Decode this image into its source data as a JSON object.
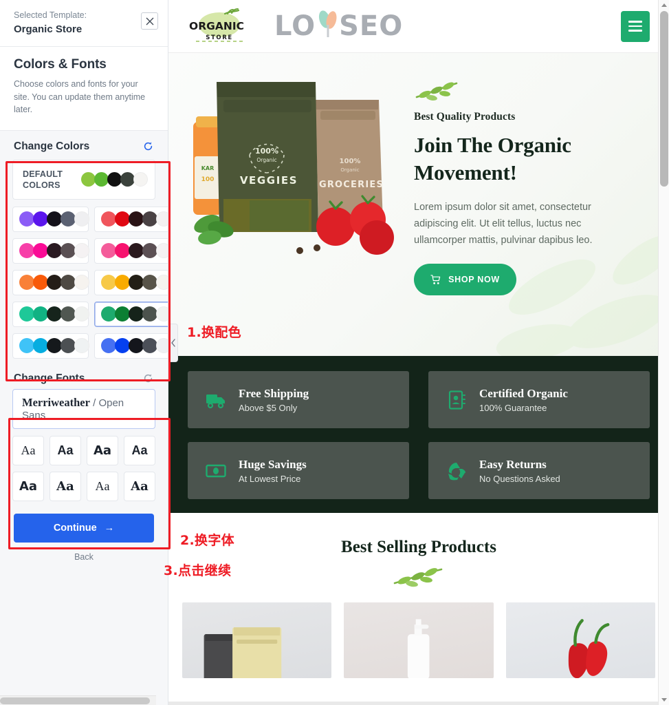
{
  "sidebar": {
    "template": {
      "label": "Selected Template:",
      "name": "Organic Store",
      "close_icon": "close-icon"
    },
    "intro": {
      "title": "Colors & Fonts",
      "description": "Choose colors and fonts for your site. You can update them anytime later."
    },
    "colors_section": {
      "title": "Change Colors",
      "reset_icon": "reset-icon",
      "default_label_line1": "DEFAULT",
      "default_label_line2": "COLORS",
      "default_swatches": [
        "#8cc63f",
        "#5cb832",
        "#111111",
        "#3b423c",
        "#f5f4f2"
      ],
      "palettes": [
        {
          "id": "purple",
          "selected": false,
          "swatches": [
            "#8b5cf6",
            "#5b16ec",
            "#14121a",
            "#5b6172",
            "#efeff1"
          ]
        },
        {
          "id": "red",
          "selected": false,
          "swatches": [
            "#f0555c",
            "#e00812",
            "#2a1315",
            "#4a4244",
            "#f4f1f1"
          ]
        },
        {
          "id": "magenta",
          "selected": false,
          "swatches": [
            "#f73fa8",
            "#fa0c96",
            "#2a1a21",
            "#5a5053",
            "#f5f2f3"
          ]
        },
        {
          "id": "pink",
          "selected": false,
          "swatches": [
            "#f45c9a",
            "#f7126e",
            "#2b1a1e",
            "#5c5054",
            "#f5f2f3"
          ]
        },
        {
          "id": "orange",
          "selected": false,
          "swatches": [
            "#f98038",
            "#f85a09",
            "#241d17",
            "#4e4943",
            "#f6f3ef"
          ]
        },
        {
          "id": "yellow",
          "selected": false,
          "swatches": [
            "#f7c948",
            "#f9ab00",
            "#231f16",
            "#585449",
            "#f5f3ee"
          ]
        },
        {
          "id": "teal",
          "selected": false,
          "swatches": [
            "#1ec898",
            "#11b283",
            "#16241c",
            "#505751",
            "#f0f2f0"
          ]
        },
        {
          "id": "green",
          "selected": true,
          "swatches": [
            "#1eab6e",
            "#0b7f33",
            "#15231a",
            "#4c534d",
            "#f1f3f0"
          ]
        },
        {
          "id": "skyblue",
          "selected": false,
          "swatches": [
            "#3fc3f7",
            "#06ade0",
            "#15191c",
            "#4c5053",
            "#eff2f3"
          ]
        },
        {
          "id": "blue",
          "selected": false,
          "swatches": [
            "#4670f2",
            "#0540f0",
            "#14161c",
            "#4b4f58",
            "#eff0f3"
          ]
        }
      ]
    },
    "fonts_section": {
      "title": "Change Fonts",
      "reset_icon": "reset-icon",
      "current_heading_font": "Merriweather",
      "current_separator": " / ",
      "current_body_font": "Open Sans",
      "tiles": [
        "Aa",
        "Aa",
        "Aa",
        "Aa",
        "Aa",
        "Aa",
        "Aa",
        "Aa"
      ]
    },
    "continue_label": "Continue",
    "continue_arrow": "→",
    "back_label": "Back"
  },
  "annotations": [
    {
      "id": "anno-1",
      "text": "1.换配色"
    },
    {
      "id": "anno-2",
      "text": "2.换字体"
    },
    {
      "id": "anno-3",
      "text": "3.点击继续"
    }
  ],
  "preview": {
    "header": {
      "logo_text_main": "ORGANIC",
      "logo_text_sub": "STORE",
      "watermark_left": "LO",
      "watermark_right": "SEO",
      "menu_icon": "hamburger-menu-icon"
    },
    "hero": {
      "sprig_icon": "leaf-sprig-icon",
      "kicker": "Best Quality Products",
      "heading_line1": "Join The Organic",
      "heading_line2": "Movement!",
      "paragraph": "Lorem ipsum dolor sit amet, consectetur adipiscing elit. Ut elit tellus, luctus nec ullamcorper mattis, pulvinar dapibus leo.",
      "cta_label": "SHOP NOW",
      "cta_icon": "shopping-cart-icon",
      "product_bag_left": "VEGGIES",
      "product_bag_right": "GROCERIES",
      "badge_text": "100%",
      "badge_sub": "Organic"
    },
    "features": [
      {
        "icon": "delivery-truck-icon",
        "title": "Free Shipping",
        "subtitle": "Above $5 Only"
      },
      {
        "icon": "certificate-icon",
        "title": "Certified Organic",
        "subtitle": "100% Guarantee"
      },
      {
        "icon": "money-note-icon",
        "title": "Huge Savings",
        "subtitle": "At Lowest Price"
      },
      {
        "icon": "recycle-icon",
        "title": "Easy Returns",
        "subtitle": "No Questions Asked"
      }
    ],
    "best_selling": {
      "title": "Best Selling Products",
      "sprig_icon": "leaf-sprig-icon",
      "products": [
        {
          "id": "product-pouches"
        },
        {
          "id": "product-pump-bottle"
        },
        {
          "id": "product-red-peppers"
        }
      ]
    },
    "accent_color": "#1eab6e",
    "dark_section_color": "#132419"
  }
}
